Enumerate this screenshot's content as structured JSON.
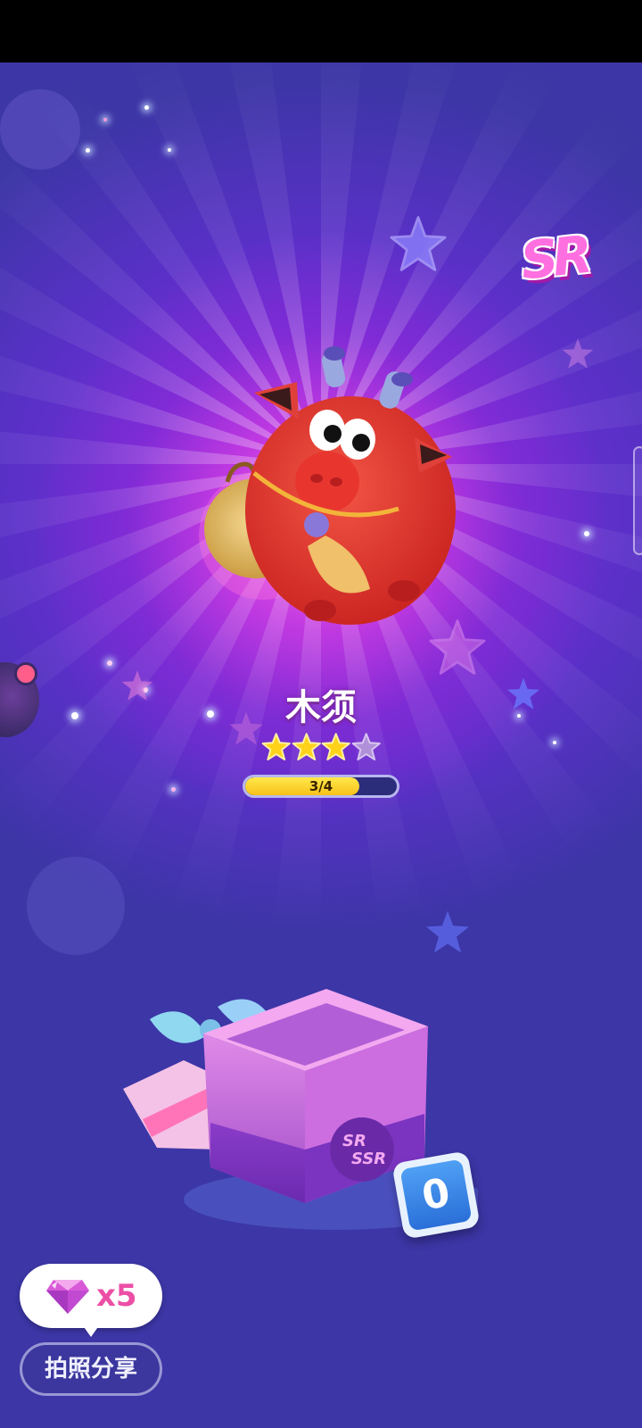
{
  "character": {
    "name": "木须",
    "rarity": "SR",
    "stars_filled": 3,
    "stars_total": 4
  },
  "progress": {
    "text": "3/4",
    "value": 0.75
  },
  "gift_box": {
    "label": "SR SSR",
    "counter": "0"
  },
  "reward": {
    "icon": "gem-icon",
    "count": "x5"
  },
  "share": {
    "label": "拍照分享"
  },
  "colors": {
    "accent_pink": "#ec4fa6",
    "progress_yellow": "#f7c11a",
    "counter_blue": "#2a6fd8",
    "background_purple": "#4a2fc6"
  }
}
